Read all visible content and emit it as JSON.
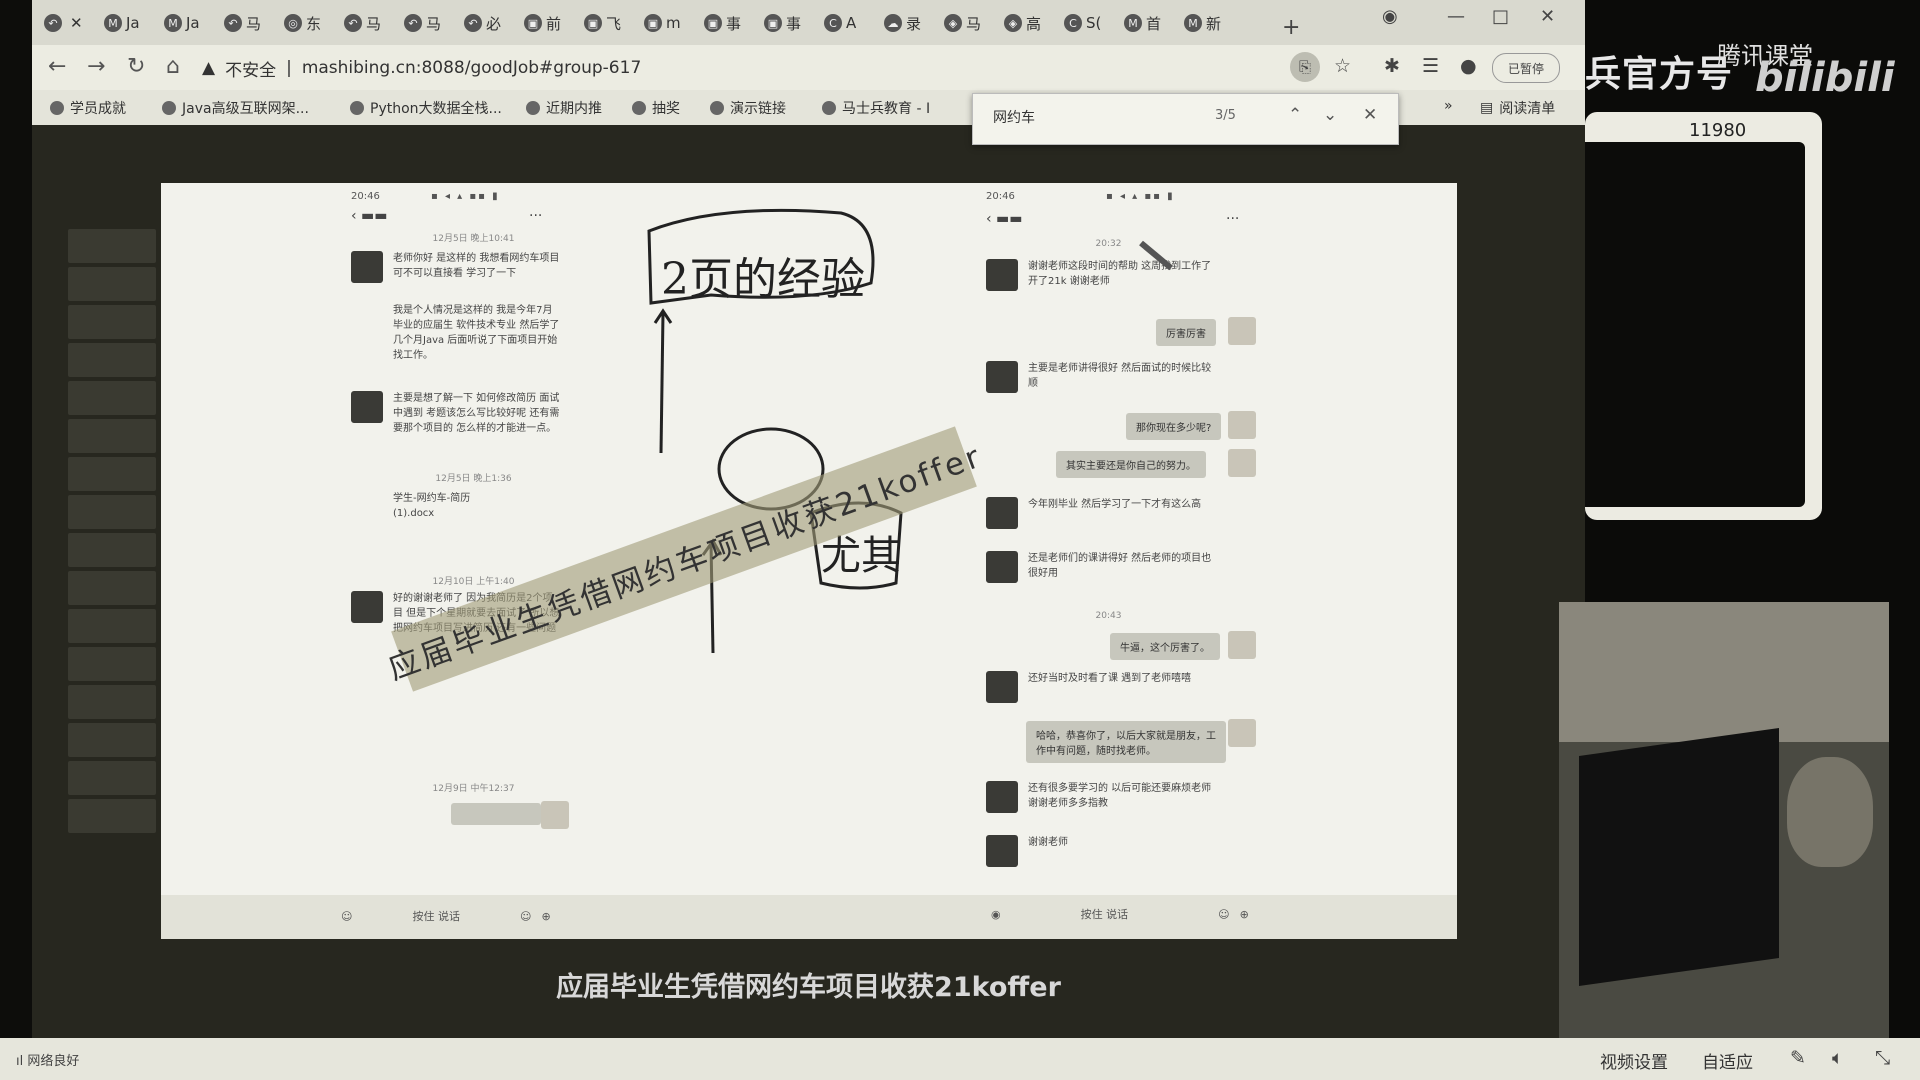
{
  "browser": {
    "tabs": [
      {
        "icon": "back-icon",
        "label": ""
      },
      {
        "icon": "ms-icon",
        "label": "Ja"
      },
      {
        "icon": "ms-icon",
        "label": "Ja"
      },
      {
        "icon": "arrow-icon",
        "label": "马"
      },
      {
        "icon": "globe-icon",
        "label": "东"
      },
      {
        "icon": "arrow-icon",
        "label": "马"
      },
      {
        "icon": "arrow-icon",
        "label": "马"
      },
      {
        "icon": "arrow-icon",
        "label": "必"
      },
      {
        "icon": "tv-icon",
        "label": "前"
      },
      {
        "icon": "tv-icon",
        "label": "飞"
      },
      {
        "icon": "tv-icon",
        "label": "m"
      },
      {
        "icon": "tv-icon",
        "label": "事"
      },
      {
        "icon": "tv-icon",
        "label": "事"
      },
      {
        "icon": "c-icon",
        "label": "A"
      },
      {
        "icon": "cloud-icon",
        "label": "录"
      },
      {
        "icon": "shield-icon",
        "label": "马"
      },
      {
        "icon": "shield-icon",
        "label": "高"
      },
      {
        "icon": "c-icon",
        "label": "S("
      },
      {
        "icon": "ms-icon",
        "label": "首"
      },
      {
        "icon": "ms-icon",
        "label": "新"
      }
    ],
    "new_tab": "+",
    "address": {
      "security": "不安全",
      "url": "mashibing.cn:8088/goodJob#group-617"
    },
    "profile_label": "已暂停",
    "bookmarks": [
      "学员成就",
      "Java高级互联网架...",
      "Python大数据全栈...",
      "近期内推",
      "抽奖",
      "演示链接",
      "马士兵教育 - I"
    ],
    "reading_list": "阅读清单",
    "find": {
      "query": "网约车",
      "count": "3/5"
    }
  },
  "slide": {
    "handwriting": {
      "top": "2页的经验",
      "right": "尤其"
    },
    "left_phone": {
      "time": "20:46",
      "timestamps": [
        "12月5日 晚上10:41",
        "12月5日 晚上1:36",
        "12月10日 上午1:40",
        "12月9日 中午12:37"
      ],
      "messages": [
        "老师你好 是这样的 我想看网约车项目可不可以直接看 学习了一下",
        "我是个人情况是这样的 我是今年7月毕业的应届生 软件技术专业 然后学了几个月Java 后面听说了下面项目开始找工作。",
        "主要是想了解一下 如何修改简历 面试中遇到 考题该怎么写比较好呢 还有需要那个项目的 怎么样的才能进一点。",
        "学生-网约车-简历(1).docx",
        "好的谢谢老师了 因为我简历是2个项目 但是下个星期就要去面试了 所以想把网约车项目写进简历 还有一些问题"
      ]
    },
    "right_phone": {
      "time": "20:46",
      "timestamps": [
        "20:32",
        "20:43"
      ],
      "messages": [
        "谢谢老师这段时间的帮助 这周找到工作了 开了21k 谢谢老师",
        "主要是老师讲得很好 然后面试的时候比较顺",
        "今年刚毕业 然后学习了一下才有这么高",
        "还是老师们的课讲得好 然后老师的项目也很好用",
        "还好当时及时看了课 遇到了老师嘻嘻",
        "还有很多要学习的 以后可能还要麻烦老师 谢谢老师多多指教",
        "谢谢老师"
      ],
      "replies": [
        "厉害厉害",
        "那你现在多少呢?",
        "其实主要还是你自己的努力。",
        "牛逼，这个厉害了。",
        "哈哈，恭喜你了，以后大家就是朋友，工作中有问题，随时找老师。"
      ]
    },
    "input_hint": "按住 说话"
  },
  "watermark": "应届毕业生凭借网约车项目收获21koffer",
  "subtitle": "应届毕业生凭借网约车项目收获21koffer",
  "stream": {
    "channel": "兵官方号",
    "tencent": "腾讯课堂",
    "bilibili": "bilibili",
    "counter": "11980"
  },
  "statusbar": {
    "network": "网络良好",
    "video_settings": "视频设置",
    "adaptive": "自适应"
  }
}
